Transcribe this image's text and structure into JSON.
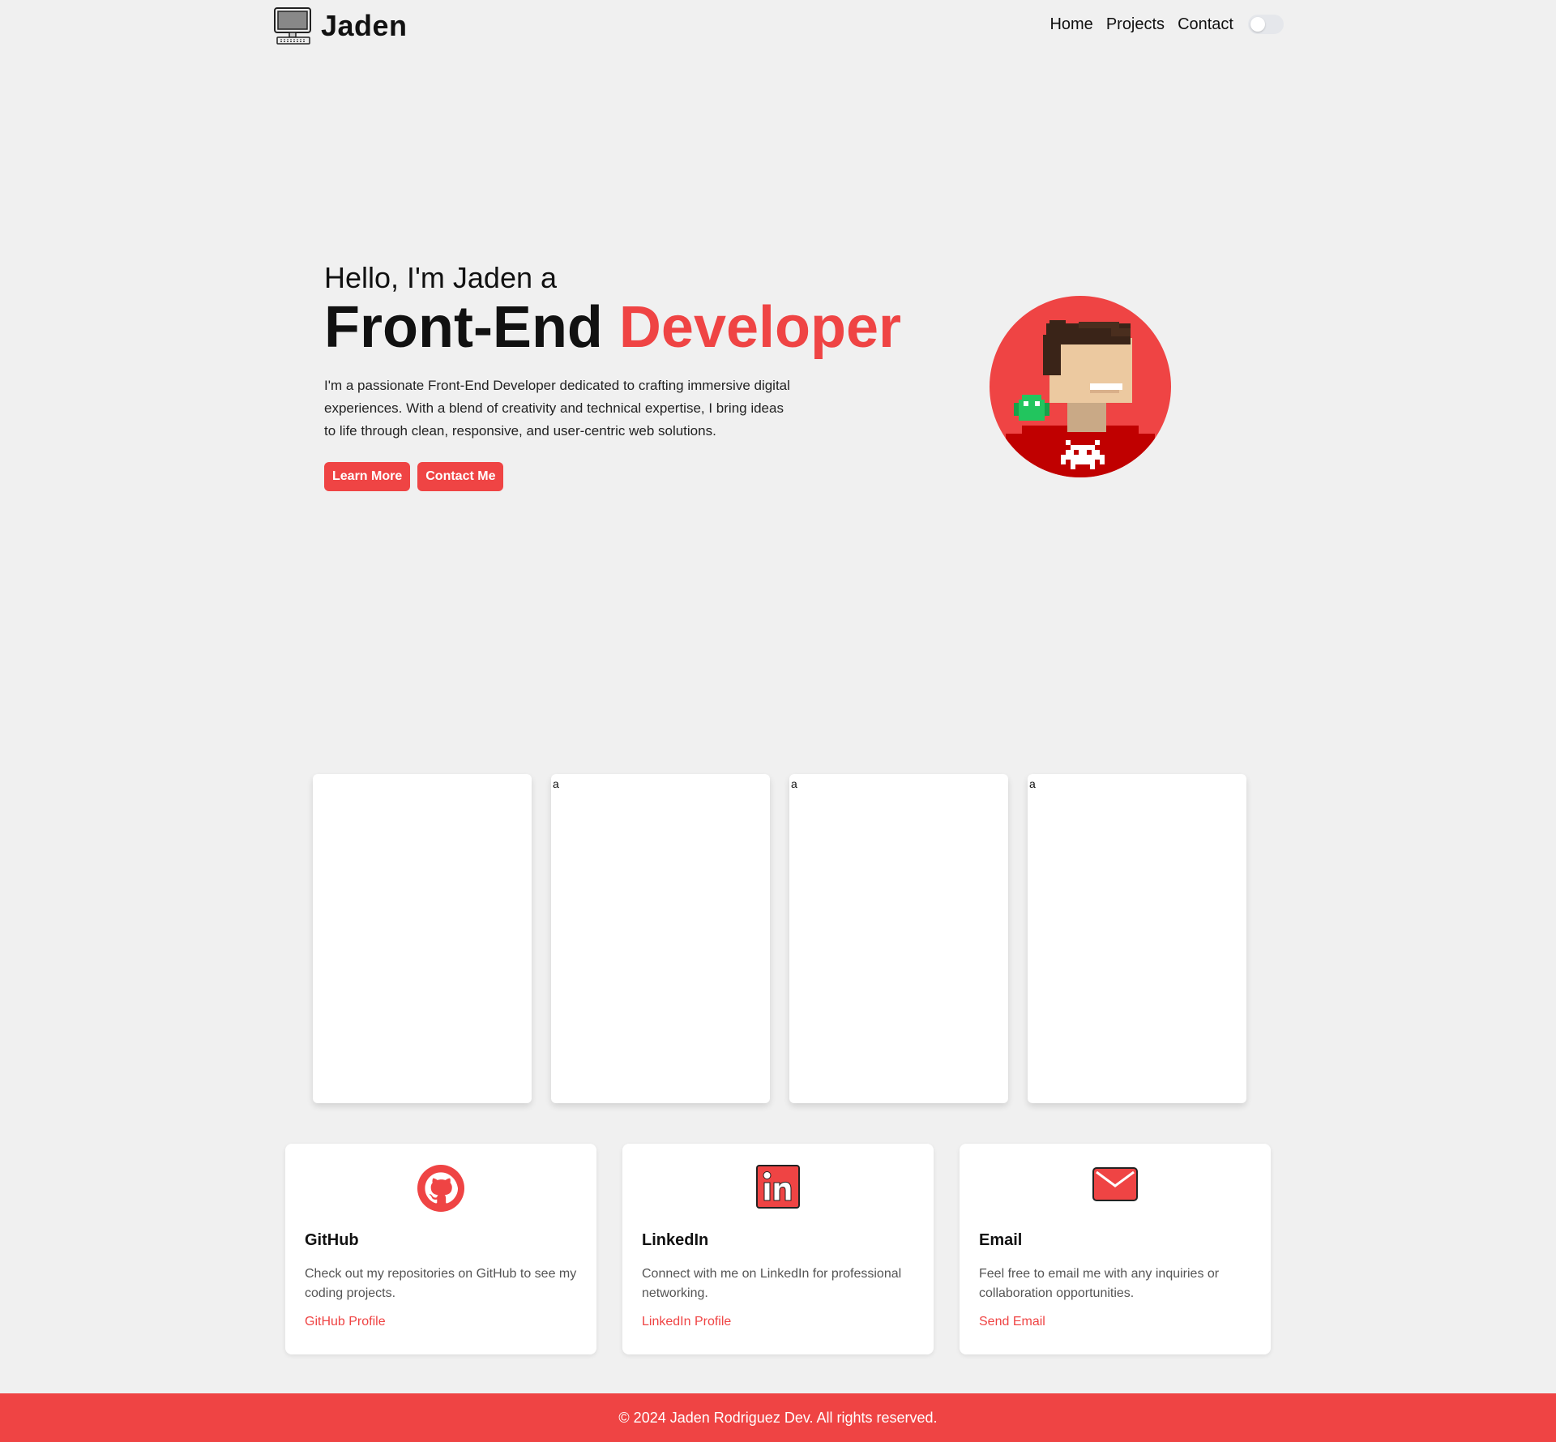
{
  "header": {
    "logo_icon": "computer-icon",
    "logo_text": "Jaden",
    "nav": {
      "home": "Home",
      "projects": "Projects",
      "contact": "Contact"
    },
    "theme_toggle_state": "off"
  },
  "hero": {
    "greeting": "Hello, I'm Jaden a",
    "title_main": "Front-End",
    "title_accent": "Developer",
    "description": "I'm a passionate Front-End Developer dedicated to crafting immersive digital experiences. With a blend of creativity and technical expertise, I bring ideas to life through clean, responsive, and user-centric web solutions.",
    "buttons": {
      "learn_more": "Learn More",
      "contact_me": "Contact Me"
    },
    "avatar_icon": "pixel-avatar-icon"
  },
  "projects": [
    {
      "text": ""
    },
    {
      "text": "a"
    },
    {
      "text": "a"
    },
    {
      "text": "a"
    }
  ],
  "contacts": [
    {
      "icon": "github-icon",
      "title": "GitHub",
      "description": "Check out my repositories on GitHub to see my coding projects.",
      "link": "GitHub Profile"
    },
    {
      "icon": "linkedin-icon",
      "title": "LinkedIn",
      "description": "Connect with me on LinkedIn for professional networking.",
      "link": "LinkedIn Profile"
    },
    {
      "icon": "email-icon",
      "title": "Email",
      "description": "Feel free to email me with any inquiries or collaboration opportunities.",
      "link": "Send Email"
    }
  ],
  "footer": {
    "text": "© 2024 Jaden Rodriguez Dev. All rights reserved."
  },
  "colors": {
    "accent": "#ef4444",
    "background": "#f0f0f0",
    "card": "#ffffff"
  }
}
